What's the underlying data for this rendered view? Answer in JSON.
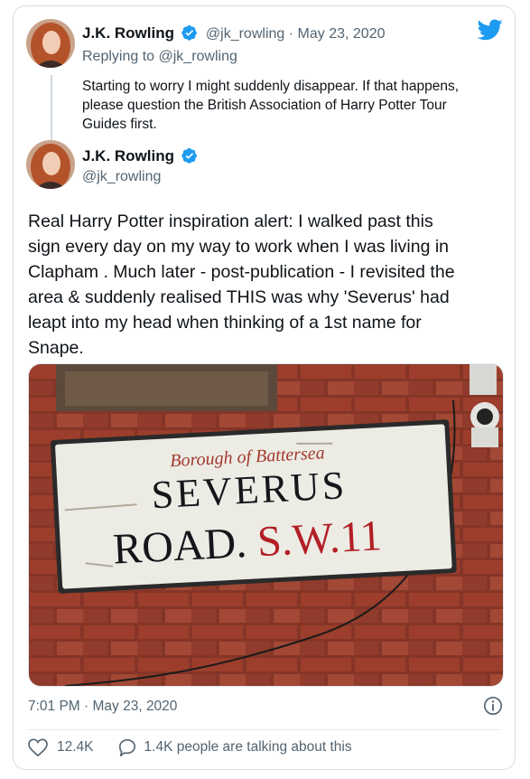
{
  "reply_tweet": {
    "name": "J.K. Rowling",
    "handle": "@jk_rowling",
    "date": "May 23, 2020",
    "replying_to": "Replying to @jk_rowling",
    "text_lines": [
      "Starting to worry I might suddenly disappear. If that happens,",
      "please question the British Association of Harry Potter Tour",
      "Guides first."
    ]
  },
  "main_tweet": {
    "name": "J.K. Rowling",
    "handle": "@jk_rowling",
    "text_lines": [
      "Real Harry Potter inspiration alert: I walked past this",
      "sign every day on my way to work when I was living in",
      "Clapham . Much later - post-publication - I revisited the",
      "area & suddenly realised THIS was why 'Severus' had",
      "leapt into my head when thinking of a 1st name for",
      "Snape."
    ],
    "timestamp": "7:01 PM · May 23, 2020",
    "likes": "12.4K",
    "talking": "1.4K people are talking about this"
  },
  "sign": {
    "line1": "Borough of Battersea",
    "line2": "SEVERUS",
    "line3_black": "ROAD.",
    "line3_red": "S.W.11"
  },
  "icons": {
    "brand": "twitter-bird-icon",
    "verified": "verified-badge-icon",
    "like": "heart-icon",
    "reply": "speech-bubble-icon",
    "info": "info-icon"
  },
  "colors": {
    "brand": "#1d9bf0",
    "text": "#0f1419",
    "secondary": "#536471"
  }
}
